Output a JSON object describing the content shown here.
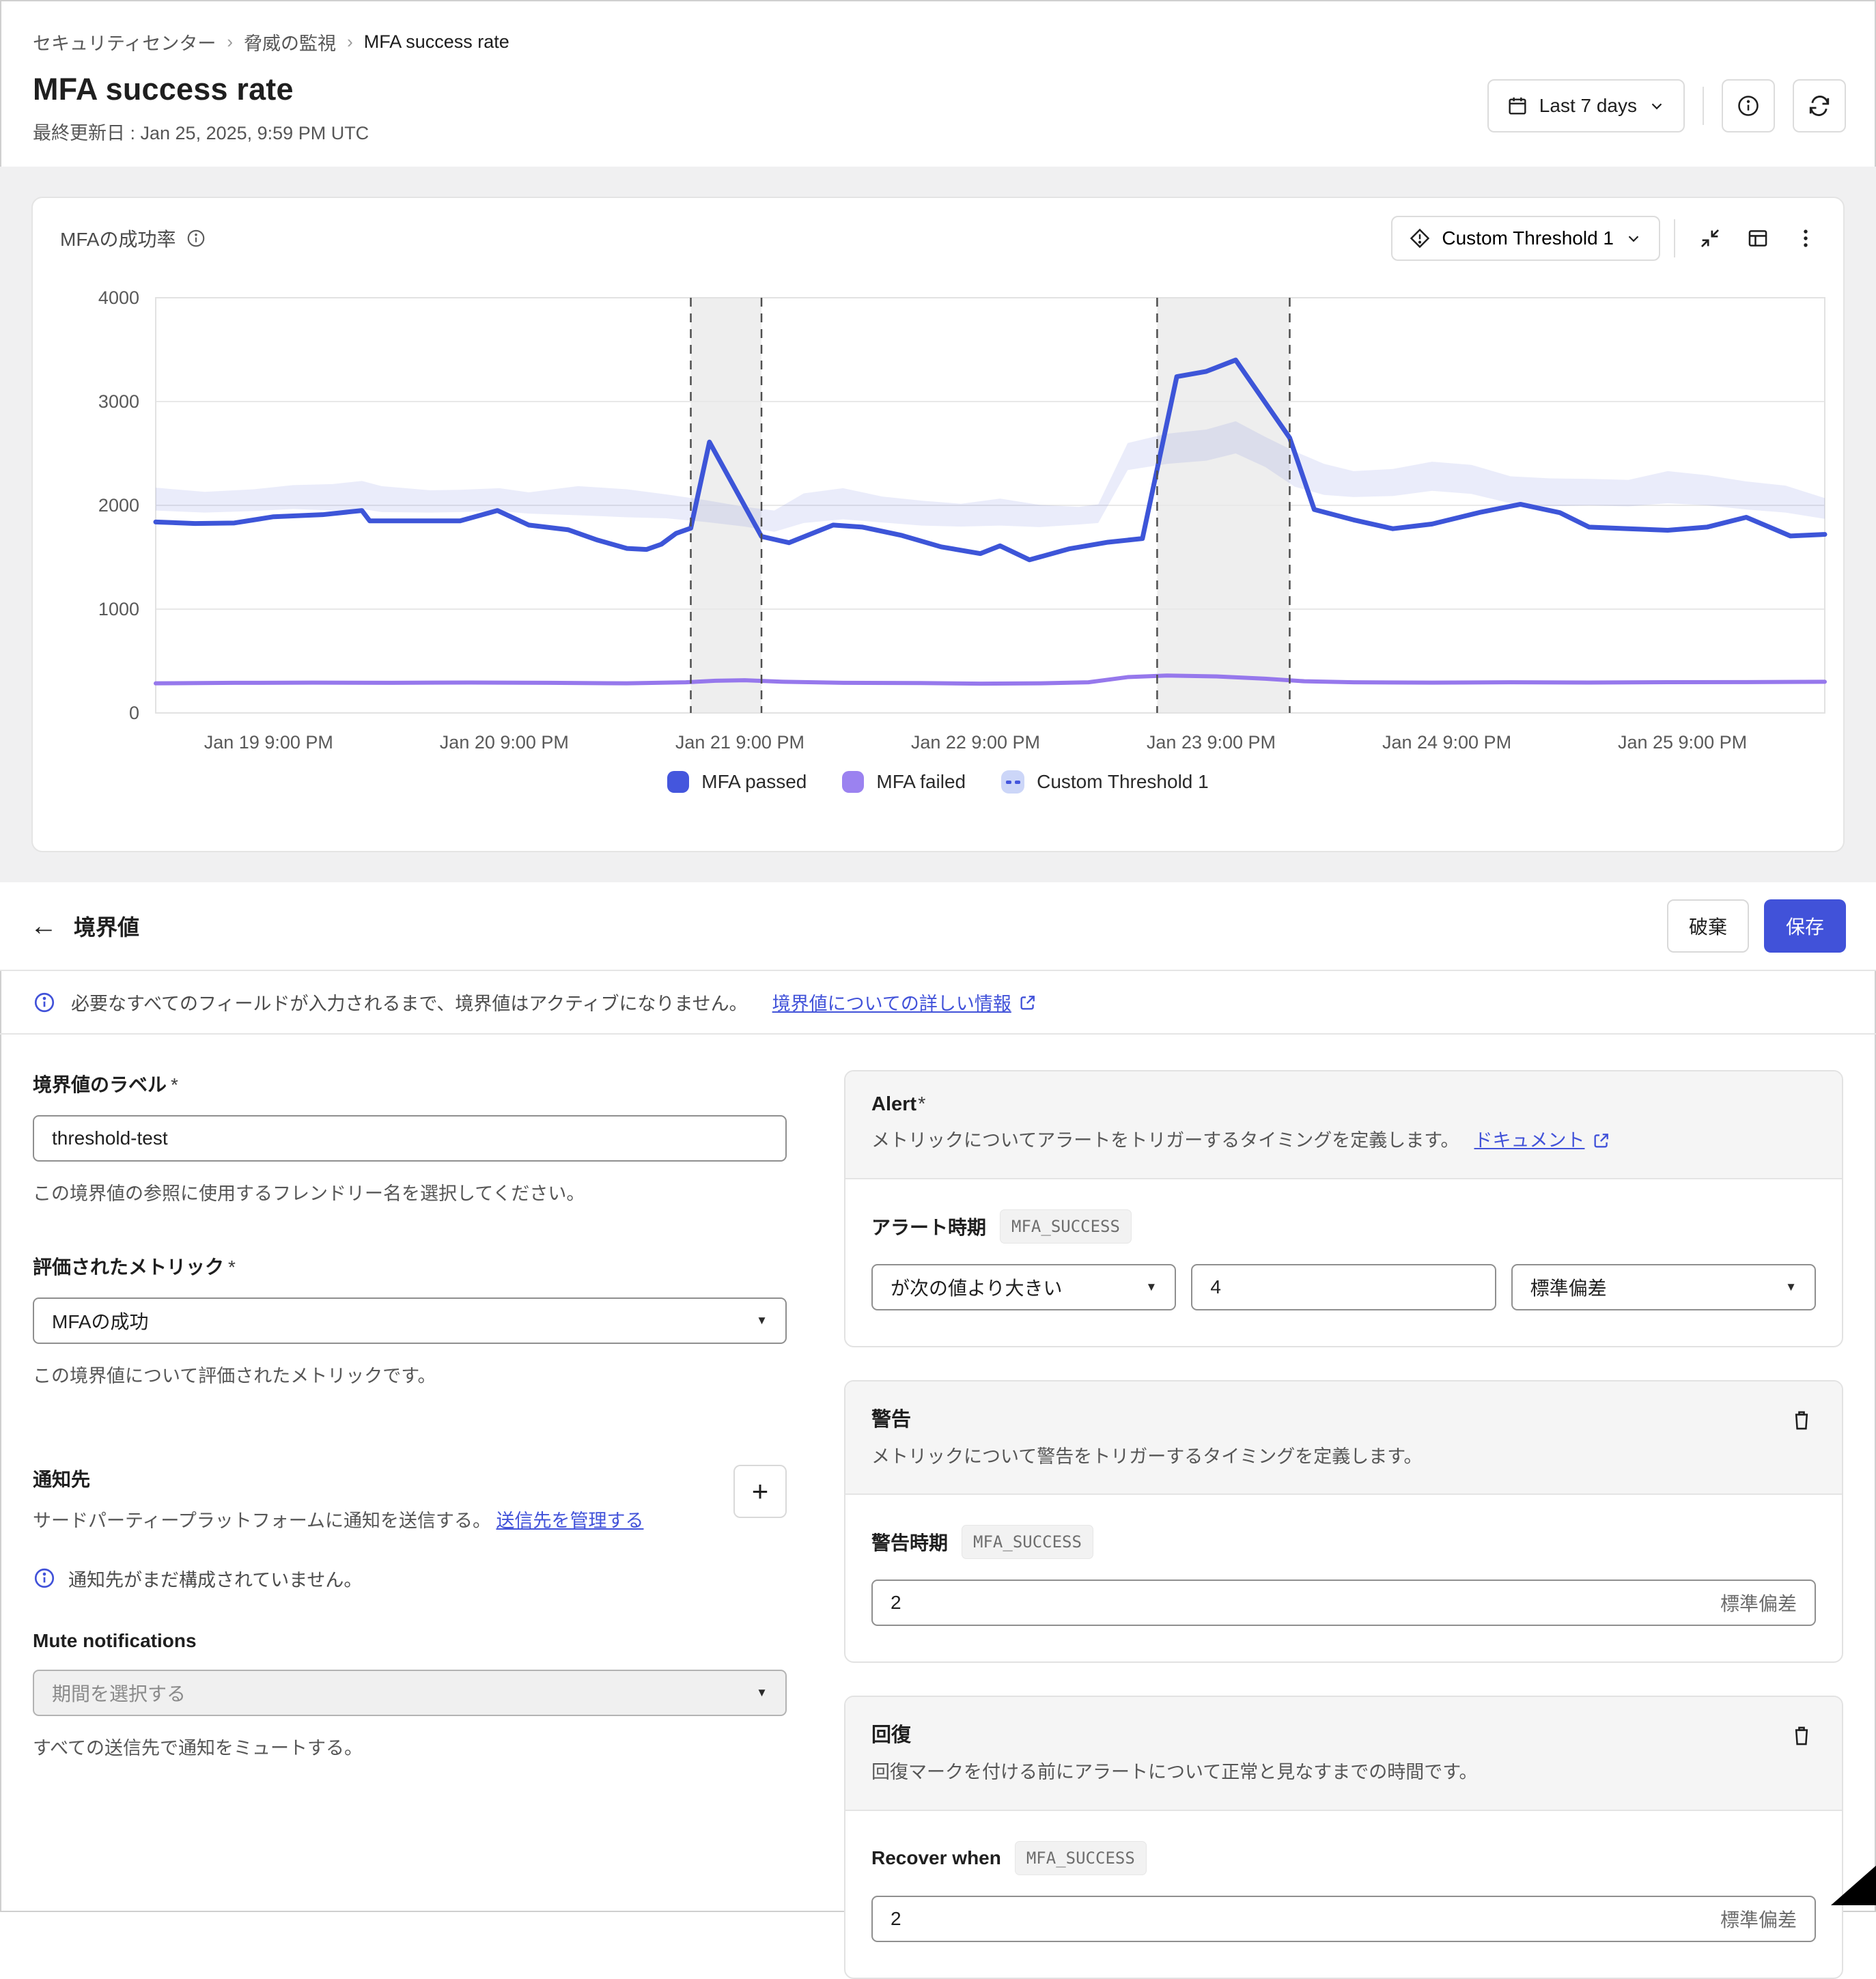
{
  "breadcrumb": {
    "items": [
      "セキュリティセンター",
      "脅威の監視",
      "MFA success rate"
    ]
  },
  "header": {
    "title": "MFA success rate",
    "last_updated": "最終更新日 : Jan 25, 2025, 9:59 PM UTC",
    "date_range_label": "Last 7 days"
  },
  "chart_card": {
    "title": "MFAの成功率",
    "threshold_selector_label": "Custom Threshold 1",
    "legend": [
      {
        "label": "MFA passed",
        "type": "dot",
        "color": "#4456dd"
      },
      {
        "label": "MFA failed",
        "type": "dot",
        "color": "#9b82f0"
      },
      {
        "label": "Custom Threshold 1",
        "type": "dashed",
        "color": "#ccd6f8",
        "dash_color": "#4456dd"
      }
    ]
  },
  "chart_data": {
    "type": "line",
    "title": "MFAの成功率",
    "x_range": [
      0,
      170
    ],
    "ylim": [
      0,
      4000
    ],
    "yticks": [
      0,
      1000,
      2000,
      3000,
      4000
    ],
    "x_ticks": [
      {
        "h": 11.5,
        "label": "Jan 19 9:00 PM"
      },
      {
        "h": 35.5,
        "label": "Jan 20 9:00 PM"
      },
      {
        "h": 59.5,
        "label": "Jan 21 9:00 PM"
      },
      {
        "h": 83.5,
        "label": "Jan 22 9:00 PM"
      },
      {
        "h": 107.5,
        "label": "Jan 23 9:00 PM"
      },
      {
        "h": 131.5,
        "label": "Jan 24 9:00 PM"
      },
      {
        "h": 155.5,
        "label": "Jan 25 9:00 PM"
      }
    ],
    "grid": true,
    "legend_position": "bottom",
    "series": [
      {
        "name": "MFA passed",
        "color": "#3d55d8",
        "width": 7,
        "points": [
          [
            0,
            1840
          ],
          [
            4,
            1825
          ],
          [
            8,
            1830
          ],
          [
            12,
            1890
          ],
          [
            17,
            1910
          ],
          [
            21,
            1950
          ],
          [
            21.8,
            1850
          ],
          [
            26,
            1850
          ],
          [
            31,
            1850
          ],
          [
            34.8,
            1950
          ],
          [
            38,
            1810
          ],
          [
            42,
            1765
          ],
          [
            45,
            1665
          ],
          [
            48,
            1585
          ],
          [
            50,
            1575
          ],
          [
            51.5,
            1625
          ],
          [
            53,
            1730
          ],
          [
            54.5,
            1780
          ],
          [
            56.4,
            2610
          ],
          [
            61.7,
            1700
          ],
          [
            64.5,
            1640
          ],
          [
            69,
            1810
          ],
          [
            72,
            1790
          ],
          [
            76,
            1710
          ],
          [
            80,
            1600
          ],
          [
            84,
            1535
          ],
          [
            86,
            1610
          ],
          [
            89,
            1475
          ],
          [
            93,
            1580
          ],
          [
            97,
            1645
          ],
          [
            100.5,
            1680
          ],
          [
            104,
            3240
          ],
          [
            107,
            3290
          ],
          [
            110,
            3400
          ],
          [
            115.5,
            2650
          ],
          [
            118,
            1960
          ],
          [
            122,
            1860
          ],
          [
            126,
            1775
          ],
          [
            130,
            1820
          ],
          [
            135,
            1935
          ],
          [
            139,
            2010
          ],
          [
            143,
            1930
          ],
          [
            146,
            1790
          ],
          [
            150,
            1775
          ],
          [
            154,
            1760
          ],
          [
            158,
            1790
          ],
          [
            162,
            1885
          ],
          [
            166.5,
            1705
          ],
          [
            170,
            1720
          ]
        ]
      },
      {
        "name": "MFA failed",
        "color": "#9678ec",
        "width": 6,
        "points": [
          [
            0,
            285
          ],
          [
            8,
            290
          ],
          [
            16,
            292
          ],
          [
            24,
            290
          ],
          [
            32,
            293
          ],
          [
            40,
            290
          ],
          [
            48,
            285
          ],
          [
            54,
            295
          ],
          [
            57,
            310
          ],
          [
            60,
            315
          ],
          [
            64,
            300
          ],
          [
            70,
            290
          ],
          [
            78,
            288
          ],
          [
            84,
            282
          ],
          [
            90,
            285
          ],
          [
            95,
            295
          ],
          [
            99,
            345
          ],
          [
            103,
            360
          ],
          [
            108,
            352
          ],
          [
            113,
            330
          ],
          [
            117,
            305
          ],
          [
            122,
            295
          ],
          [
            130,
            292
          ],
          [
            138,
            295
          ],
          [
            146,
            293
          ],
          [
            154,
            296
          ],
          [
            162,
            297
          ],
          [
            170,
            300
          ]
        ]
      }
    ],
    "band": {
      "name": "Custom Threshold 1",
      "color": "#5a6ed9",
      "opacity": 0.13,
      "points": [
        [
          0,
          1950,
          2170
        ],
        [
          5,
          1930,
          2130
        ],
        [
          10,
          1945,
          2155
        ],
        [
          14,
          1965,
          2195
        ],
        [
          18,
          1950,
          2205
        ],
        [
          21,
          1965,
          2235
        ],
        [
          23,
          1935,
          2185
        ],
        [
          28,
          1930,
          2145
        ],
        [
          31,
          1935,
          2150
        ],
        [
          35,
          1945,
          2165
        ],
        [
          38,
          1920,
          2125
        ],
        [
          43,
          1905,
          2185
        ],
        [
          48,
          1885,
          2155
        ],
        [
          52,
          1875,
          2105
        ],
        [
          56,
          1840,
          2050
        ],
        [
          60,
          1795,
          1985
        ],
        [
          63,
          1745,
          1950
        ],
        [
          66,
          1830,
          2115
        ],
        [
          70,
          1865,
          2165
        ],
        [
          74,
          1835,
          2085
        ],
        [
          78,
          1805,
          2045
        ],
        [
          82,
          1795,
          2015
        ],
        [
          86,
          1805,
          2065
        ],
        [
          90,
          1790,
          2005
        ],
        [
          94,
          1815,
          1985
        ],
        [
          96,
          1830,
          2010
        ],
        [
          99,
          2340,
          2600
        ],
        [
          103,
          2400,
          2690
        ],
        [
          107,
          2430,
          2730
        ],
        [
          110,
          2500,
          2810
        ],
        [
          113,
          2370,
          2660
        ],
        [
          116,
          2180,
          2520
        ],
        [
          119,
          2100,
          2400
        ],
        [
          122,
          2080,
          2330
        ],
        [
          126,
          2090,
          2350
        ],
        [
          130,
          2140,
          2420
        ],
        [
          134,
          2110,
          2390
        ],
        [
          138,
          2020,
          2280
        ],
        [
          142,
          1990,
          2260
        ],
        [
          146,
          2000,
          2255
        ],
        [
          150,
          1990,
          2245
        ],
        [
          154,
          2020,
          2330
        ],
        [
          158,
          2000,
          2290
        ],
        [
          162,
          1960,
          2230
        ],
        [
          166,
          1930,
          2190
        ],
        [
          170,
          1870,
          2070
        ]
      ]
    },
    "anomaly_regions": [
      {
        "from": 54.5,
        "to": 61.7
      },
      {
        "from": 102,
        "to": 115.5
      }
    ]
  },
  "threshold_section": {
    "title": "境界値",
    "discard_label": "破棄",
    "save_label": "保存",
    "banner_text": "必要なすべてのフィールドが入力されるまで、境界値はアクティブになりません。",
    "banner_link": "境界値についての詳しい情報"
  },
  "form": {
    "label_field": {
      "label": "境界値のラベル",
      "required_mark": "*",
      "value": "threshold-test",
      "help": "この境界値の参照に使用するフレンドリー名を選択してください。"
    },
    "metric_field": {
      "label": "評価されたメトリック",
      "required_mark": "*",
      "value": "MFAの成功",
      "help": "この境界値について評価されたメトリックです。"
    },
    "notifications": {
      "title": "通知先",
      "desc": "サードパーティープラットフォームに通知を送信する。",
      "manage_link": "送信先を管理する",
      "add_label": "+",
      "empty_info": "通知先がまだ構成されていません。"
    },
    "mute": {
      "title": "Mute notifications",
      "placeholder": "期間を選択する",
      "help": "すべての送信先で通知をミュートする。"
    }
  },
  "cards": {
    "alert": {
      "title": "Alert",
      "required_mark": "*",
      "desc": "メトリックについてアラートをトリガーするタイミングを定義します。",
      "doc_link": "ドキュメント",
      "when_label": "アラート時期",
      "badge": "MFA_SUCCESS",
      "condition": "が次の値より大きい",
      "value": "4",
      "unit": "標準偏差"
    },
    "warning": {
      "title": "警告",
      "desc": "メトリックについて警告をトリガーするタイミングを定義します。",
      "when_label": "警告時期",
      "badge": "MFA_SUCCESS",
      "value": "2",
      "unit": "標準偏差"
    },
    "recovery": {
      "title": "回復",
      "desc": "回復マークを付ける前にアラートについて正常と見なすまでの時間です。",
      "when_label": "Recover when",
      "badge": "MFA_SUCCESS",
      "value": "2",
      "unit": "標準偏差"
    }
  },
  "colors": {
    "accent": "#4152d9",
    "passed_line": "#3d55d8",
    "failed_line": "#9678ec",
    "band": "#e8ecf9",
    "anomaly_fill": "#ececec"
  }
}
